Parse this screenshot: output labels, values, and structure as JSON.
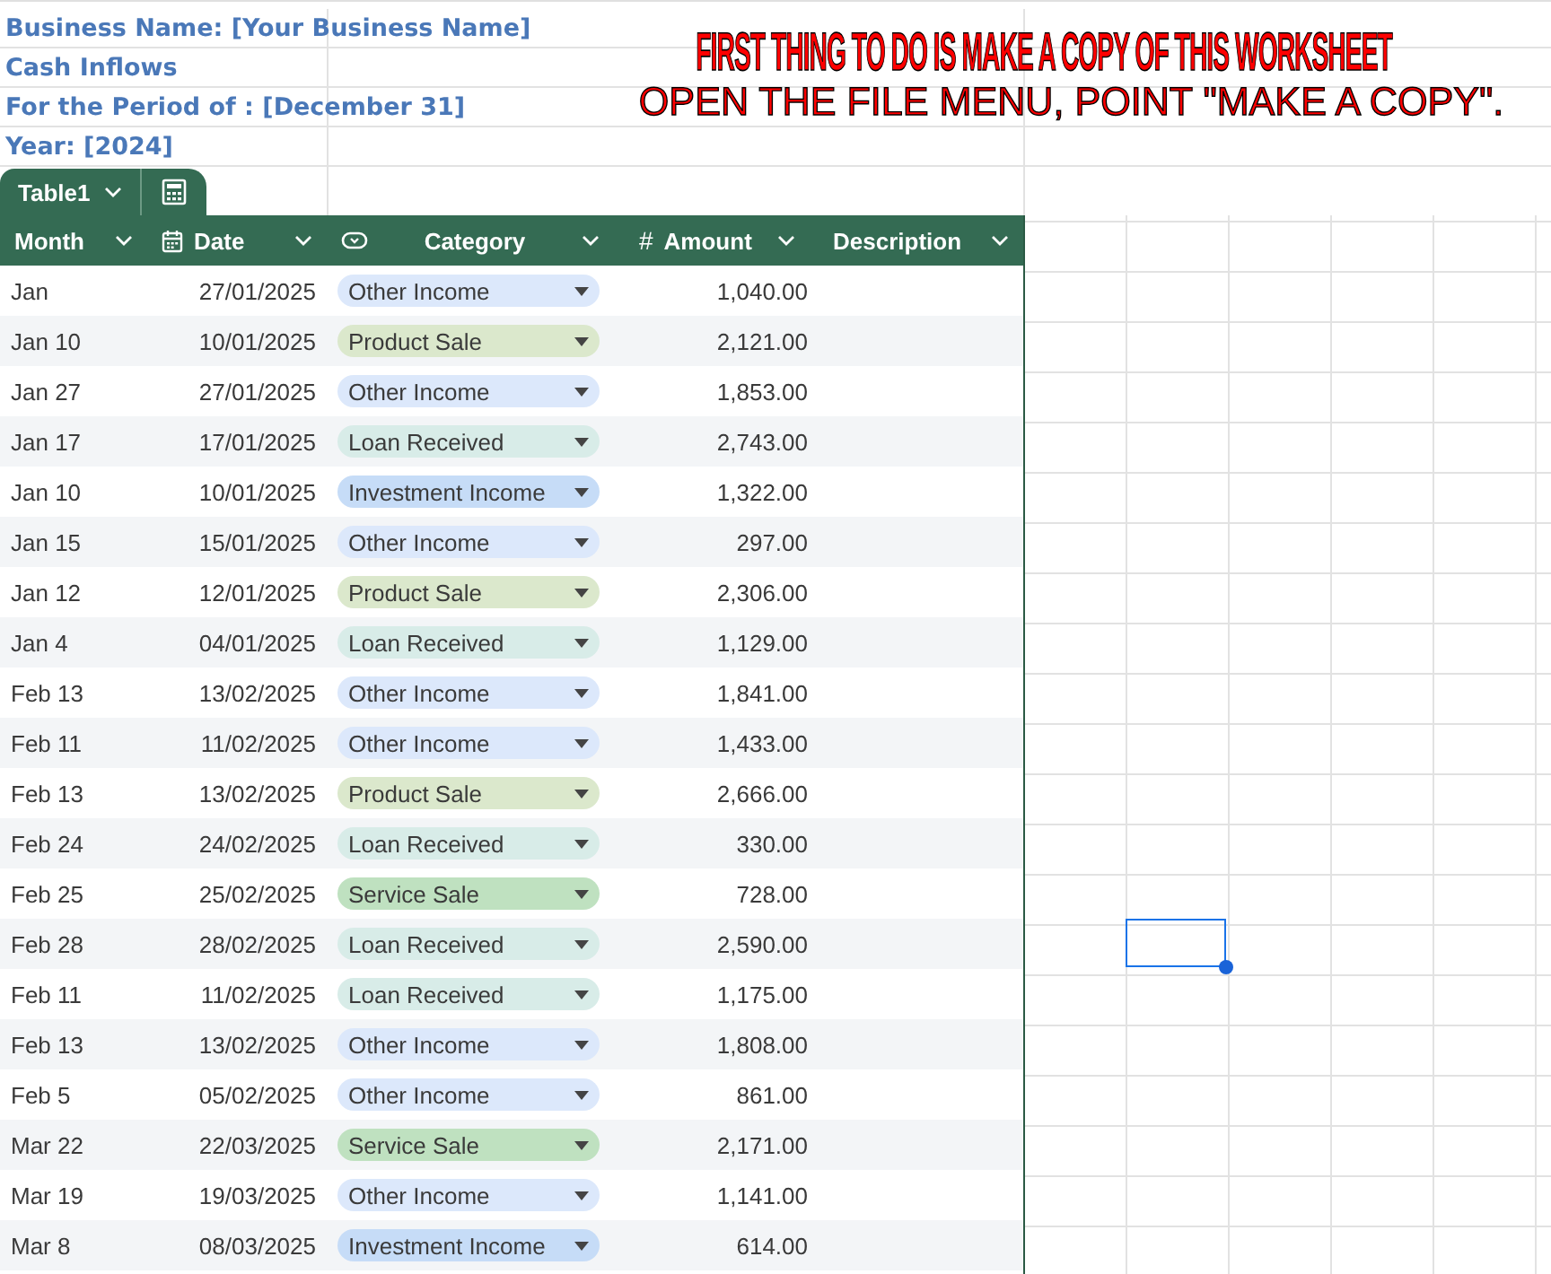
{
  "header": {
    "lines": [
      "Business Name: [Your Business Name]",
      "Cash Inflows",
      "For the Period of : [December 31]",
      "Year: [2024]"
    ]
  },
  "banner": {
    "line_1": "FIRST THING TO DO IS MAKE A COPY OF THIS WORKSHEET",
    "line_2": "OPEN THE FILE MENU, POINT \"MAKE A COPY\"."
  },
  "table": {
    "name": "Table1",
    "columns": [
      {
        "label": "Month",
        "kind": "text"
      },
      {
        "label": "Date",
        "kind": "date"
      },
      {
        "label": "Category",
        "kind": "dropdown"
      },
      {
        "label": "Amount",
        "kind": "number",
        "symbol": "#"
      },
      {
        "label": "Description",
        "kind": "text"
      }
    ],
    "rows": [
      {
        "month": "Jan",
        "date": "27/01/2025",
        "category": "Other Income",
        "color": "#dce8fb",
        "amount": "1,040.00"
      },
      {
        "month": "Jan 10",
        "date": "10/01/2025",
        "category": "Product Sale",
        "color": "#dbe8cc",
        "amount": "2,121.00"
      },
      {
        "month": "Jan 27",
        "date": "27/01/2025",
        "category": "Other Income",
        "color": "#dce8fb",
        "amount": "1,853.00"
      },
      {
        "month": "Jan 17",
        "date": "17/01/2025",
        "category": "Loan Received",
        "color": "#d8ece8",
        "amount": "2,743.00"
      },
      {
        "month": "Jan 10",
        "date": "10/01/2025",
        "category": "Investment Income",
        "color": "#c6dcf7",
        "amount": "1,322.00"
      },
      {
        "month": "Jan 15",
        "date": "15/01/2025",
        "category": "Other Income",
        "color": "#dce8fb",
        "amount": "297.00"
      },
      {
        "month": "Jan 12",
        "date": "12/01/2025",
        "category": "Product Sale",
        "color": "#dbe8cc",
        "amount": "2,306.00"
      },
      {
        "month": "Jan 4",
        "date": "04/01/2025",
        "category": "Loan Received",
        "color": "#d8ece8",
        "amount": "1,129.00"
      },
      {
        "month": "Feb 13",
        "date": "13/02/2025",
        "category": "Other Income",
        "color": "#dce8fb",
        "amount": "1,841.00"
      },
      {
        "month": "Feb 11",
        "date": "11/02/2025",
        "category": "Other Income",
        "color": "#dce8fb",
        "amount": "1,433.00"
      },
      {
        "month": "Feb 13",
        "date": "13/02/2025",
        "category": "Product Sale",
        "color": "#dbe8cc",
        "amount": "2,666.00"
      },
      {
        "month": "Feb 24",
        "date": "24/02/2025",
        "category": "Loan Received",
        "color": "#d8ece8",
        "amount": "330.00"
      },
      {
        "month": "Feb 25",
        "date": "25/02/2025",
        "category": "Service Sale",
        "color": "#bfe1c0",
        "amount": "728.00"
      },
      {
        "month": "Feb 28",
        "date": "28/02/2025",
        "category": "Loan Received",
        "color": "#d8ece8",
        "amount": "2,590.00"
      },
      {
        "month": "Feb 11",
        "date": "11/02/2025",
        "category": "Loan Received",
        "color": "#d8ece8",
        "amount": "1,175.00"
      },
      {
        "month": "Feb 13",
        "date": "13/02/2025",
        "category": "Other Income",
        "color": "#dce8fb",
        "amount": "1,808.00"
      },
      {
        "month": "Feb 5",
        "date": "05/02/2025",
        "category": "Other Income",
        "color": "#dce8fb",
        "amount": "861.00"
      },
      {
        "month": "Mar 22",
        "date": "22/03/2025",
        "category": "Service Sale",
        "color": "#bfe1c0",
        "amount": "2,171.00"
      },
      {
        "month": "Mar 19",
        "date": "19/03/2025",
        "category": "Other Income",
        "color": "#dce8fb",
        "amount": "1,141.00"
      },
      {
        "month": "Mar 8",
        "date": "08/03/2025",
        "category": "Investment Income",
        "color": "#c6dcf7",
        "amount": "614.00"
      }
    ]
  }
}
